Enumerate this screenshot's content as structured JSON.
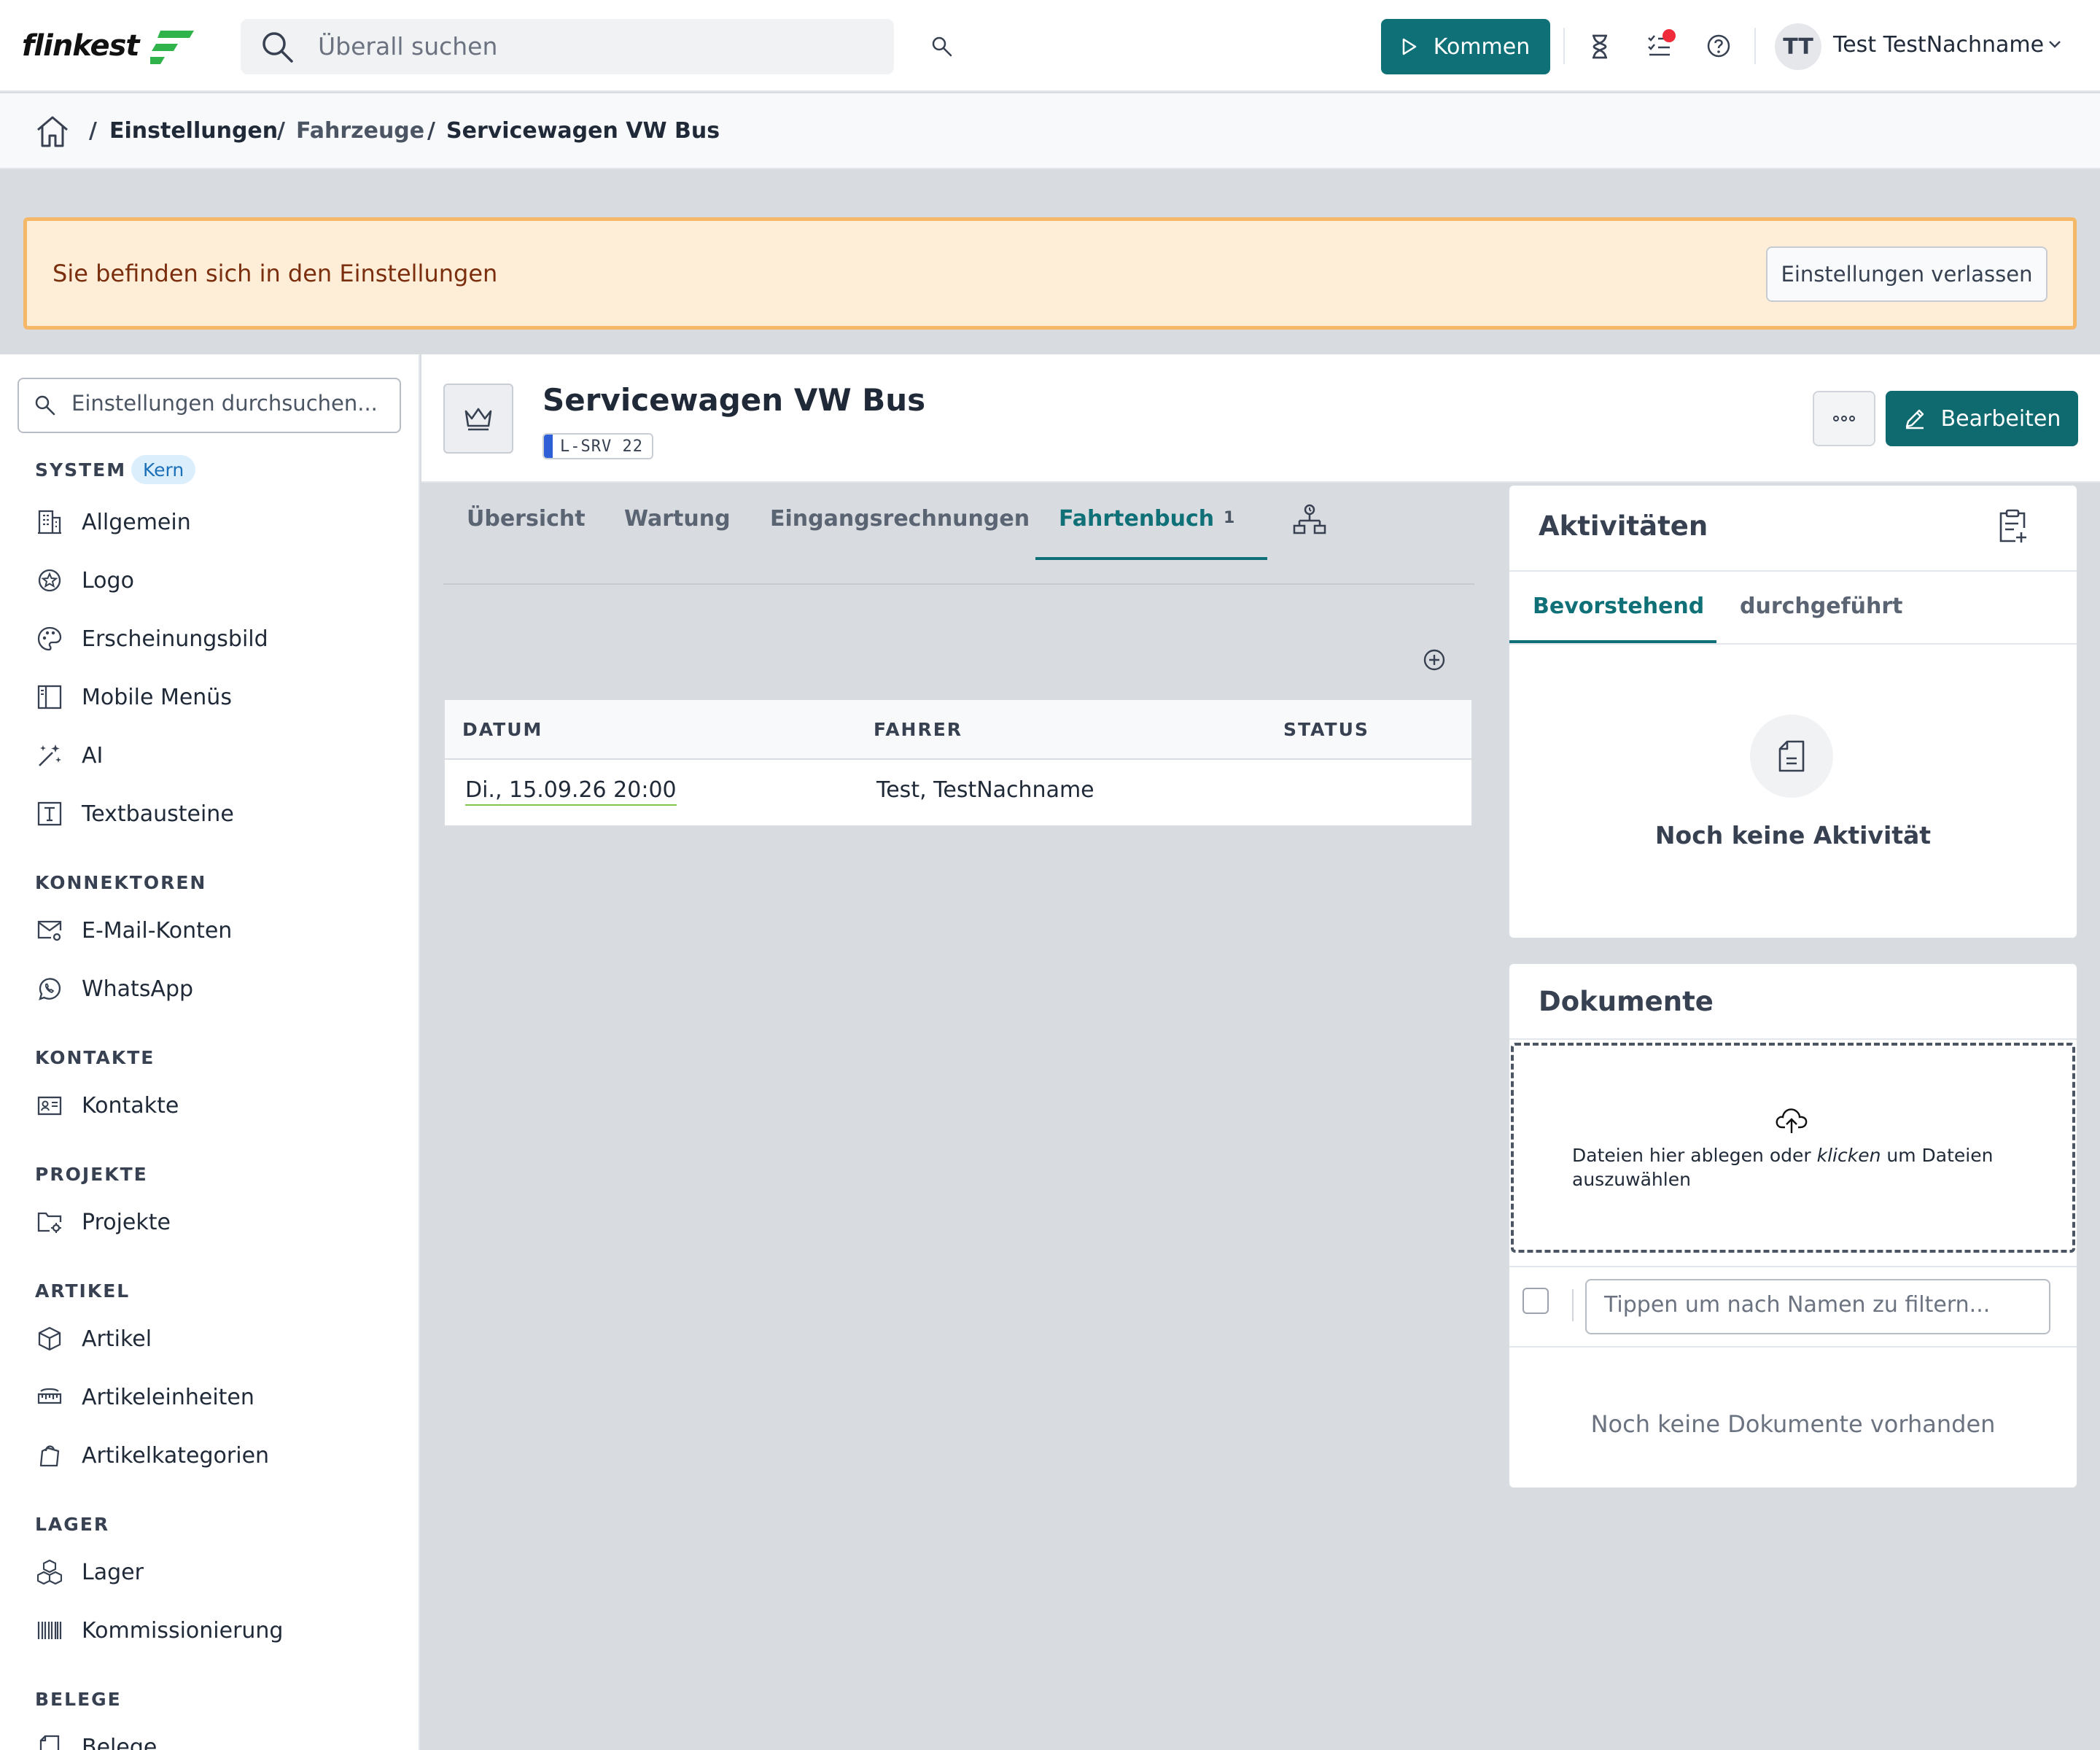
{
  "topbar": {
    "logo_text": "flinkest",
    "search_placeholder": "Überall suchen",
    "kommen_label": "Kommen",
    "user_initials": "TT",
    "user_name": "Test TestNachname",
    "brand_color": "#0f7177",
    "icons": [
      "search-icon",
      "hourglass-icon",
      "tasks-icon",
      "help-icon",
      "chevron-down-icon"
    ]
  },
  "breadcrumb": {
    "items": [
      "Einstellungen",
      "Fahrzeuge",
      "Servicewagen VW Bus"
    ],
    "separator": "/"
  },
  "banner": {
    "text": "Sie befinden sich in den Einstellungen",
    "button_label": "Einstellungen verlassen"
  },
  "sidebar": {
    "search_placeholder": "Einstellungen durchsuchen...",
    "sections": [
      {
        "title": "SYSTEM",
        "badge": "Kern",
        "items": [
          "Allgemein",
          "Logo",
          "Erscheinungsbild",
          "Mobile Menüs",
          "AI",
          "Textbausteine"
        ]
      },
      {
        "title": "KONNEKTOREN",
        "items": [
          "E-Mail-Konten",
          "WhatsApp"
        ]
      },
      {
        "title": "KONTAKTE",
        "items": [
          "Kontakte"
        ]
      },
      {
        "title": "PROJEKTE",
        "items": [
          "Projekte"
        ]
      },
      {
        "title": "ARTIKEL",
        "items": [
          "Artikel",
          "Artikeleinheiten",
          "Artikelkategorien"
        ]
      },
      {
        "title": "LAGER",
        "items": [
          "Lager",
          "Kommissionierung"
        ]
      },
      {
        "title": "BELEGE",
        "items": [
          "Belege"
        ]
      }
    ]
  },
  "record": {
    "title": "Servicewagen VW Bus",
    "tag": "L-SRV 22",
    "more_label": "···",
    "edit_label": "Bearbeiten"
  },
  "tabs": {
    "items": [
      "Übersicht",
      "Wartung",
      "Eingangsrechnungen",
      "Fahrtenbuch"
    ],
    "active": "Fahrtenbuch",
    "active_count": "1"
  },
  "logbook": {
    "columns": [
      "DATUM",
      "FAHRER",
      "STATUS"
    ],
    "rows": [
      {
        "datum": "Di., 15.09.26 20:00",
        "fahrer": "Test, TestNachname",
        "status": ""
      }
    ]
  },
  "activities": {
    "title": "Aktivitäten",
    "tabs": [
      "Bevorstehend",
      "durchgeführt"
    ],
    "active_tab": "Bevorstehend",
    "empty": "Noch keine Aktivität"
  },
  "documents": {
    "title": "Dokumente",
    "drop_text_1": "Dateien hier ablegen oder ",
    "drop_text_em": "klicken",
    "drop_text_2": " um Dateien auszuwählen",
    "filter_placeholder": "Tippen um nach Namen zu filtern...",
    "empty": "Noch keine Dokumente vorhanden"
  }
}
